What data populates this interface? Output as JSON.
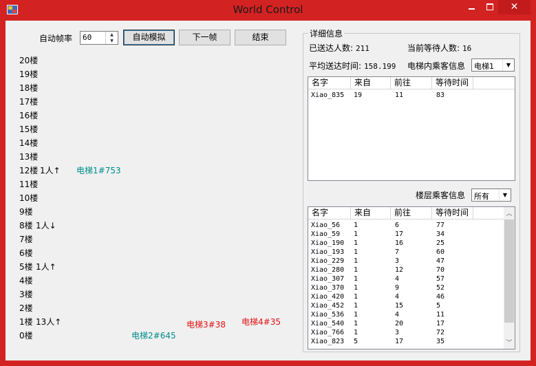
{
  "window": {
    "title": "World Control",
    "minimize": "—",
    "maximize": "□",
    "close": "✕"
  },
  "controls": {
    "fps_label": "自动帧率",
    "fps_value": "60",
    "auto_button": "自动模拟",
    "next_button": "下一帧",
    "end_button": "结束"
  },
  "floors": [
    {
      "label": "20楼",
      "waiting": ""
    },
    {
      "label": "19楼",
      "waiting": ""
    },
    {
      "label": "18楼",
      "waiting": ""
    },
    {
      "label": "17楼",
      "waiting": ""
    },
    {
      "label": "16楼",
      "waiting": ""
    },
    {
      "label": "15楼",
      "waiting": ""
    },
    {
      "label": "14楼",
      "waiting": ""
    },
    {
      "label": "13楼",
      "waiting": ""
    },
    {
      "label": "12楼",
      "waiting": "1人↑"
    },
    {
      "label": "11楼",
      "waiting": ""
    },
    {
      "label": "10楼",
      "waiting": ""
    },
    {
      "label": "9楼",
      "waiting": ""
    },
    {
      "label": "8楼",
      "waiting": "1人↓"
    },
    {
      "label": "7楼",
      "waiting": ""
    },
    {
      "label": "6楼",
      "waiting": ""
    },
    {
      "label": "5楼",
      "waiting": "1人↑"
    },
    {
      "label": "4楼",
      "waiting": ""
    },
    {
      "label": "3楼",
      "waiting": ""
    },
    {
      "label": "2楼",
      "waiting": ""
    },
    {
      "label": "1楼",
      "waiting": "13人↑"
    },
    {
      "label": "0楼",
      "waiting": ""
    }
  ],
  "elevators": [
    {
      "label": "电梯1#753",
      "color": "#008b8b"
    },
    {
      "label": "电梯2#645",
      "color": "#008b8b"
    },
    {
      "label": "电梯3#38",
      "color": "#e01010"
    },
    {
      "label": "电梯4#35",
      "color": "#e01010"
    }
  ],
  "detail": {
    "group_title": "详细信息",
    "delivered_label": "已送达人数:",
    "delivered_value": "211",
    "waiting_label": "当前等待人数:",
    "waiting_value": "16",
    "avg_label": "平均送达时间:",
    "avg_value": "158.199",
    "elevator_passengers_label": "电梯内乘客信息",
    "elevator_select": "电梯1",
    "floor_passengers_label": "楼层乘客信息",
    "floor_select": "所有"
  },
  "columns": [
    "名字",
    "来自",
    "前往",
    "等待时间"
  ],
  "elevator_rows": [
    [
      "Xiao_835",
      "19",
      "11",
      "83"
    ]
  ],
  "floor_rows": [
    [
      "Xiao_56",
      "1",
      "6",
      "77"
    ],
    [
      "Xiao_59",
      "1",
      "17",
      "34"
    ],
    [
      "Xiao_190",
      "1",
      "16",
      "25"
    ],
    [
      "Xiao_193",
      "1",
      "7",
      "60"
    ],
    [
      "Xiao_229",
      "1",
      "3",
      "47"
    ],
    [
      "Xiao_280",
      "1",
      "12",
      "70"
    ],
    [
      "Xiao_307",
      "1",
      "4",
      "57"
    ],
    [
      "Xiao_370",
      "1",
      "9",
      "52"
    ],
    [
      "Xiao_420",
      "1",
      "4",
      "46"
    ],
    [
      "Xiao_452",
      "1",
      "15",
      "5"
    ],
    [
      "Xiao_536",
      "1",
      "4",
      "11"
    ],
    [
      "Xiao_540",
      "1",
      "20",
      "17"
    ],
    [
      "Xiao_766",
      "1",
      "3",
      "72"
    ],
    [
      "Xiao_823",
      "5",
      "17",
      "35"
    ]
  ],
  "scroll_icons": {
    "up": "︿",
    "down": "﹀"
  }
}
